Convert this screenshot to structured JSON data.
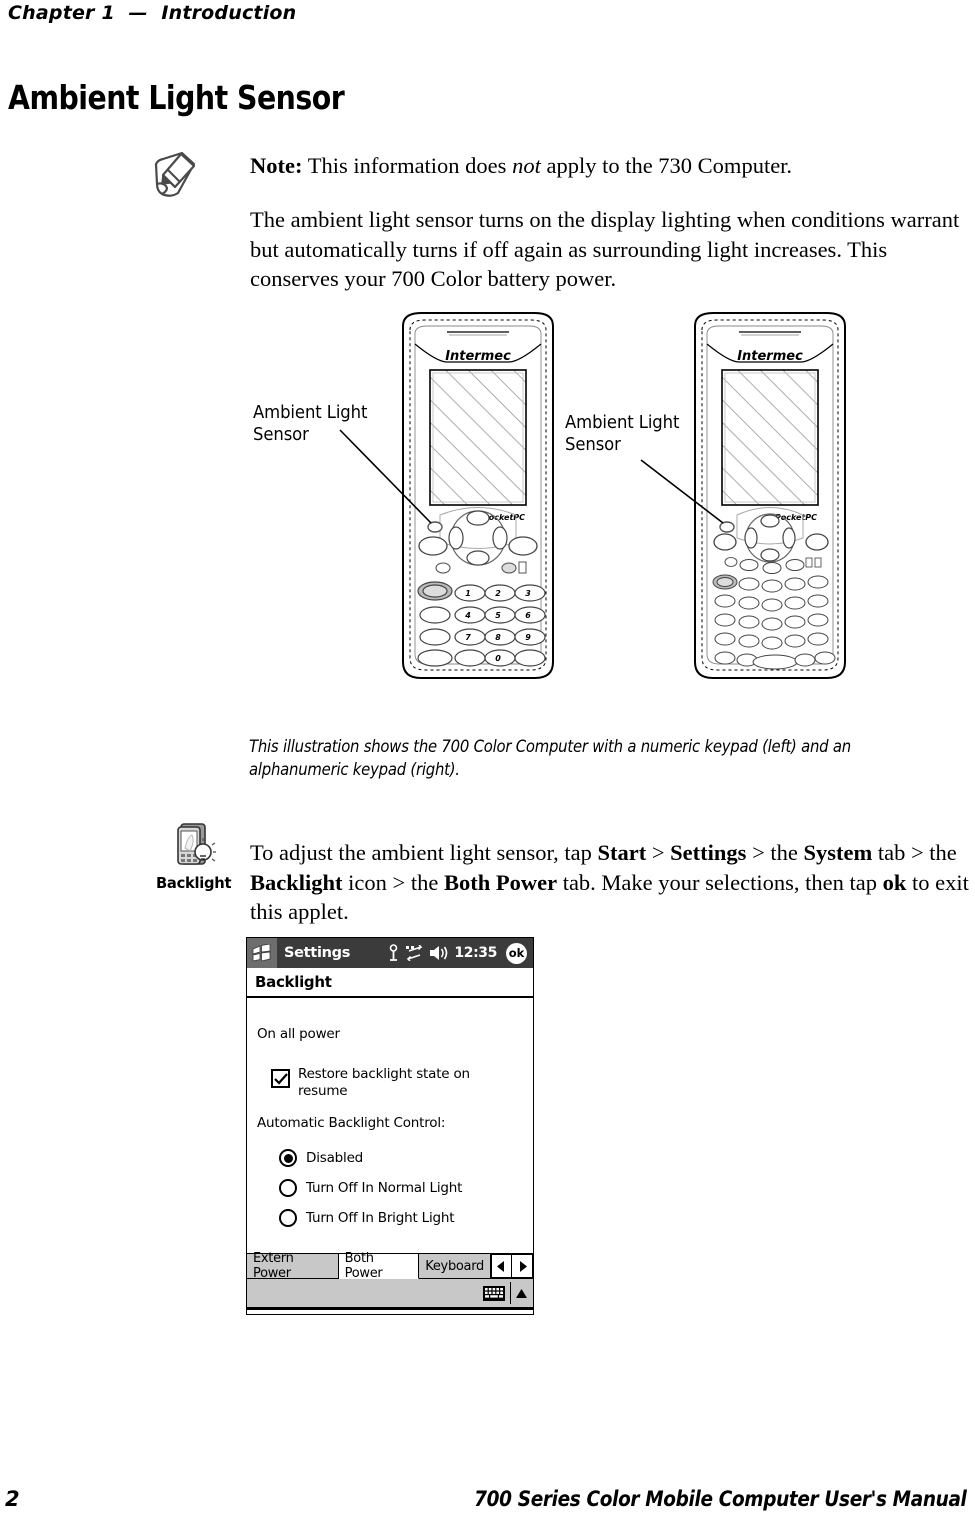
{
  "header": {
    "running_head": "Chapter 1  —  Introduction"
  },
  "page_title": "Ambient Light Sensor",
  "note": {
    "icon": "note-pencil-icon",
    "lead": "Note:",
    "text_before_italic": " This information does ",
    "italic_word": "not",
    "text_after_italic": " apply to the 730 Computer."
  },
  "body_paragraph": "The ambient light sensor turns on the display lighting when conditions warrant but automatically turns if off again as surrounding light increases. This conserves your 700 Color battery power.",
  "illustration": {
    "left_device": {
      "brand": "Intermec",
      "platform": "PocketPC",
      "callout": "Ambient Light\nSensor",
      "keypad_type": "numeric"
    },
    "right_device": {
      "brand": "Intermec",
      "platform": "PocketPC",
      "callout": "Ambient Light\nSensor",
      "keypad_type": "alphanumeric"
    }
  },
  "caption": "This illustration shows the 700 Color Computer with a numeric keypad (left) and an alphanumeric keypad (right).",
  "applet_instruction": {
    "icon_label": "Backlight",
    "icon": "backlight-applet-icon",
    "segments": [
      {
        "text": "To adjust the ambient light sensor, tap ",
        "bold": false
      },
      {
        "text": "Start",
        "bold": true
      },
      {
        "text": " > ",
        "bold": false
      },
      {
        "text": "Settings",
        "bold": true
      },
      {
        "text": " > the ",
        "bold": false
      },
      {
        "text": "System",
        "bold": true
      },
      {
        "text": " tab > the ",
        "bold": false
      },
      {
        "text": "Backlight",
        "bold": true
      },
      {
        "text": " icon > the ",
        "bold": false
      },
      {
        "text": "Both Power",
        "bold": true
      },
      {
        "text": " tab. Make your selections, then tap ",
        "bold": false
      },
      {
        "text": "ok",
        "bold": true
      },
      {
        "text": " to exit this applet.",
        "bold": false
      }
    ]
  },
  "screenshot": {
    "titlebar": {
      "start_icon": "windows-flag-icon",
      "app_title": "Settings",
      "status_icons": [
        "antenna-icon",
        "network-connection-icon",
        "speaker-volume-icon"
      ],
      "clock": "12:35",
      "ok_button": "ok"
    },
    "page_header": "Backlight",
    "section_label": "On all power",
    "checkbox": {
      "label": "Restore backlight state on resume",
      "checked": true
    },
    "group_label": "Automatic Backlight Control:",
    "radio_options": [
      {
        "label": "Disabled",
        "selected": true
      },
      {
        "label": "Turn Off In Normal Light",
        "selected": false
      },
      {
        "label": "Turn Off In Bright Light",
        "selected": false
      }
    ],
    "tabs": [
      {
        "label": "Extern Power",
        "active": false
      },
      {
        "label": "Both Power",
        "active": true
      },
      {
        "label": "Keyboard",
        "active": false
      }
    ],
    "tab_scroll": {
      "left": "◀",
      "right": "▶"
    },
    "statusbar": {
      "sip_icon": "keyboard-icon",
      "sip_arrow": "▲"
    }
  },
  "footer": {
    "page_number": "2",
    "manual_title": "700 Series Color Mobile Computer User's Manual"
  }
}
